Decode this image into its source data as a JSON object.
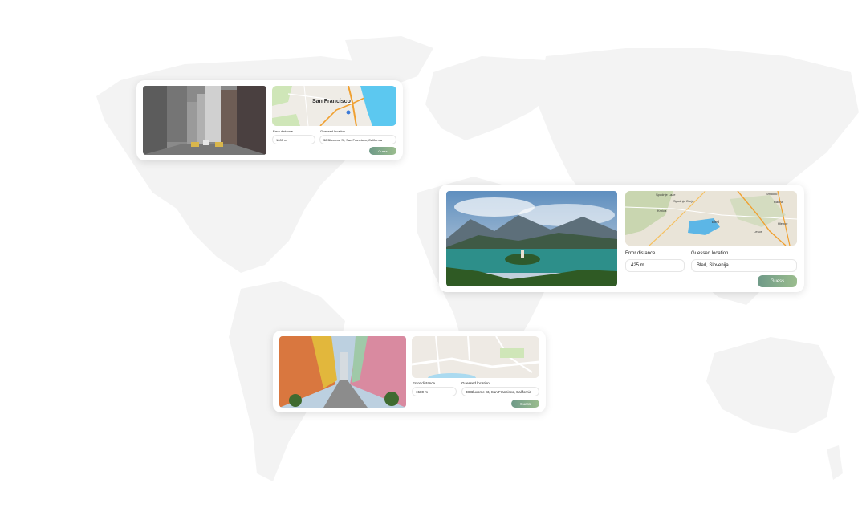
{
  "cards": [
    {
      "map_city_label": "San Francisco",
      "error_label": "Error distance",
      "error_value": "1600 m",
      "guessed_label": "Guessed location",
      "guessed_value": "38 Bluxome St, San Francisco, California",
      "guess_button": "Guess"
    },
    {
      "map_labels": [
        "Spodnje Laze",
        "Spodnje Gorje",
        "Krnica",
        "Bled",
        "Smokuč",
        "Radna",
        "Hlebce",
        "Lesce"
      ],
      "error_label": "Error distance",
      "error_value": "425 m",
      "guessed_label": "Guessed location",
      "guessed_value": "Bled, Slovenija",
      "guess_button": "Guess"
    },
    {
      "error_label": "Error distance",
      "error_value": "1580 m",
      "guessed_label": "Guessed location",
      "guessed_value": "38 Bluxome St, San Francisco, California",
      "guess_button": "Guess"
    }
  ]
}
